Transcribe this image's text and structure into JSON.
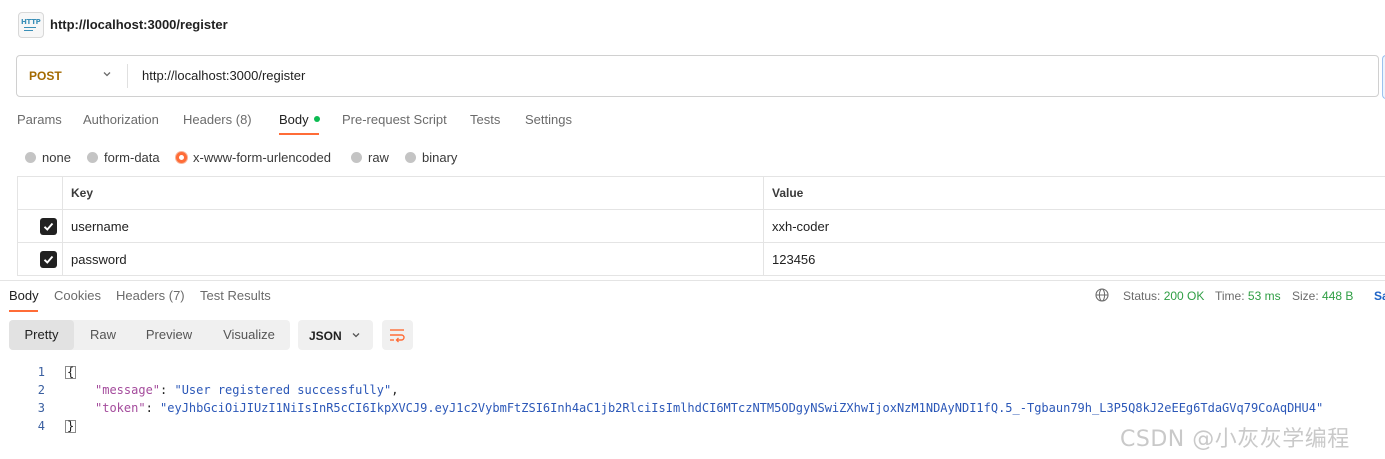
{
  "request": {
    "icon": "http-file-icon",
    "icon_text": "HTTP",
    "title": "http://localhost:3000/register",
    "method": "POST",
    "url": "http://localhost:3000/register"
  },
  "request_tabs": [
    {
      "label": "Params"
    },
    {
      "label": "Authorization"
    },
    {
      "label": "Headers (8)"
    },
    {
      "label": "Body",
      "active": true
    },
    {
      "label": "Pre-request Script"
    },
    {
      "label": "Tests"
    },
    {
      "label": "Settings"
    }
  ],
  "body_types": [
    {
      "label": "none"
    },
    {
      "label": "form-data"
    },
    {
      "label": "x-www-form-urlencoded",
      "selected": true
    },
    {
      "label": "raw"
    },
    {
      "label": "binary"
    }
  ],
  "table": {
    "headers": {
      "key": "Key",
      "value": "Value"
    },
    "rows": [
      {
        "checked": true,
        "key": "username",
        "value": "xxh-coder"
      },
      {
        "checked": true,
        "key": "password",
        "value": "123456"
      }
    ]
  },
  "response_tabs": [
    {
      "label": "Body",
      "active": true
    },
    {
      "label": "Cookies"
    },
    {
      "label": "Headers (7)"
    },
    {
      "label": "Test Results"
    }
  ],
  "status": {
    "status_label": "Status:",
    "status_value": "200 OK",
    "time_label": "Time:",
    "time_value": "53 ms",
    "size_label": "Size:",
    "size_value": "448 B",
    "save_label": "Sa"
  },
  "view_modes": [
    {
      "label": "Pretty",
      "active": true
    },
    {
      "label": "Raw"
    },
    {
      "label": "Preview"
    },
    {
      "label": "Visualize"
    }
  ],
  "format": "JSON",
  "code": {
    "line_numbers": [
      "1",
      "2",
      "3",
      "4"
    ],
    "open_brace": "{",
    "close_brace": "}",
    "message_key": "\"message\"",
    "message_value": "\"User registered successfully\"",
    "token_key": "\"token\"",
    "token_value": "\"eyJhbGciOiJIUzI1NiIsInR5cCI6IkpXVCJ9.eyJ1c2VybmFtZSI6Inh4aC1jb2RlciIsImlhdCI6MTczNTM5ODgyNSwiZXhwIjoxNzM1NDAyNDI1fQ.5_-Tgbaun79h_L3P5Q8kJ2eEEg6TdaGVq79CoAqDHU4\""
  },
  "watermark": "CSDN @小灰灰学编程",
  "colors": {
    "accent": "#ff6c37",
    "status_ok": "#2f9e44",
    "method_post": "#a36a00"
  }
}
